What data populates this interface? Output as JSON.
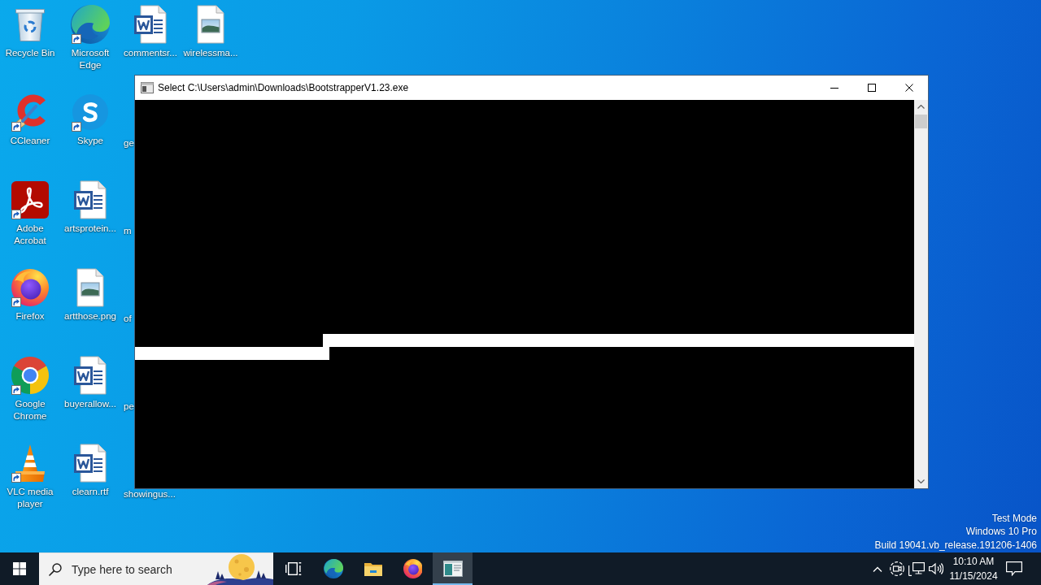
{
  "desktop": {
    "columns": [
      [
        {
          "label": "Recycle Bin",
          "kind": "recycle-bin",
          "shortcut": false
        },
        {
          "label": "CCleaner",
          "kind": "ccleaner",
          "shortcut": true
        },
        {
          "label": "Adobe Acrobat",
          "kind": "acrobat",
          "shortcut": true
        },
        {
          "label": "Firefox",
          "kind": "firefox",
          "shortcut": true
        },
        {
          "label": "Google Chrome",
          "kind": "chrome",
          "shortcut": true
        },
        {
          "label": "VLC media player",
          "kind": "vlc",
          "shortcut": true
        }
      ],
      [
        {
          "label": "Microsoft Edge",
          "kind": "edge",
          "shortcut": true
        },
        {
          "label": "Skype",
          "kind": "skype",
          "shortcut": true
        },
        {
          "label": "artsprotein...",
          "kind": "word",
          "shortcut": false
        },
        {
          "label": "artthose.png",
          "kind": "image",
          "shortcut": false
        },
        {
          "label": "buyerallow...",
          "kind": "word",
          "shortcut": false
        },
        {
          "label": "clearn.rtf",
          "kind": "word",
          "shortcut": false
        }
      ],
      [
        {
          "label": "commentsr...",
          "kind": "word",
          "shortcut": false
        },
        {
          "label": "ge",
          "kind": "covered"
        },
        {
          "label": "m",
          "kind": "covered"
        },
        {
          "label": "of",
          "kind": "covered"
        },
        {
          "label": "pe",
          "kind": "covered"
        },
        {
          "label": "showingus...",
          "kind": "covered"
        }
      ],
      [
        {
          "label": "wirelessma...",
          "kind": "image",
          "shortcut": false
        }
      ]
    ],
    "system_info": [
      "Test Mode",
      "Windows 10 Pro",
      "Build 19041.vb_release.191206-1406"
    ]
  },
  "window": {
    "title": "Select C:\\Users\\admin\\Downloads\\BootstrapperV1.23.exe",
    "console": {
      "has_selection": true
    }
  },
  "taskbar": {
    "search": {
      "placeholder": "Type here to search"
    },
    "apps": [
      {
        "kind": "task-view",
        "selected": false
      },
      {
        "kind": "edge",
        "selected": false
      },
      {
        "kind": "folder",
        "selected": false
      },
      {
        "kind": "firefox",
        "selected": false
      },
      {
        "kind": "console",
        "selected": true
      }
    ],
    "tray": {
      "time": "10:10 AM",
      "date": "11/15/2024"
    }
  }
}
